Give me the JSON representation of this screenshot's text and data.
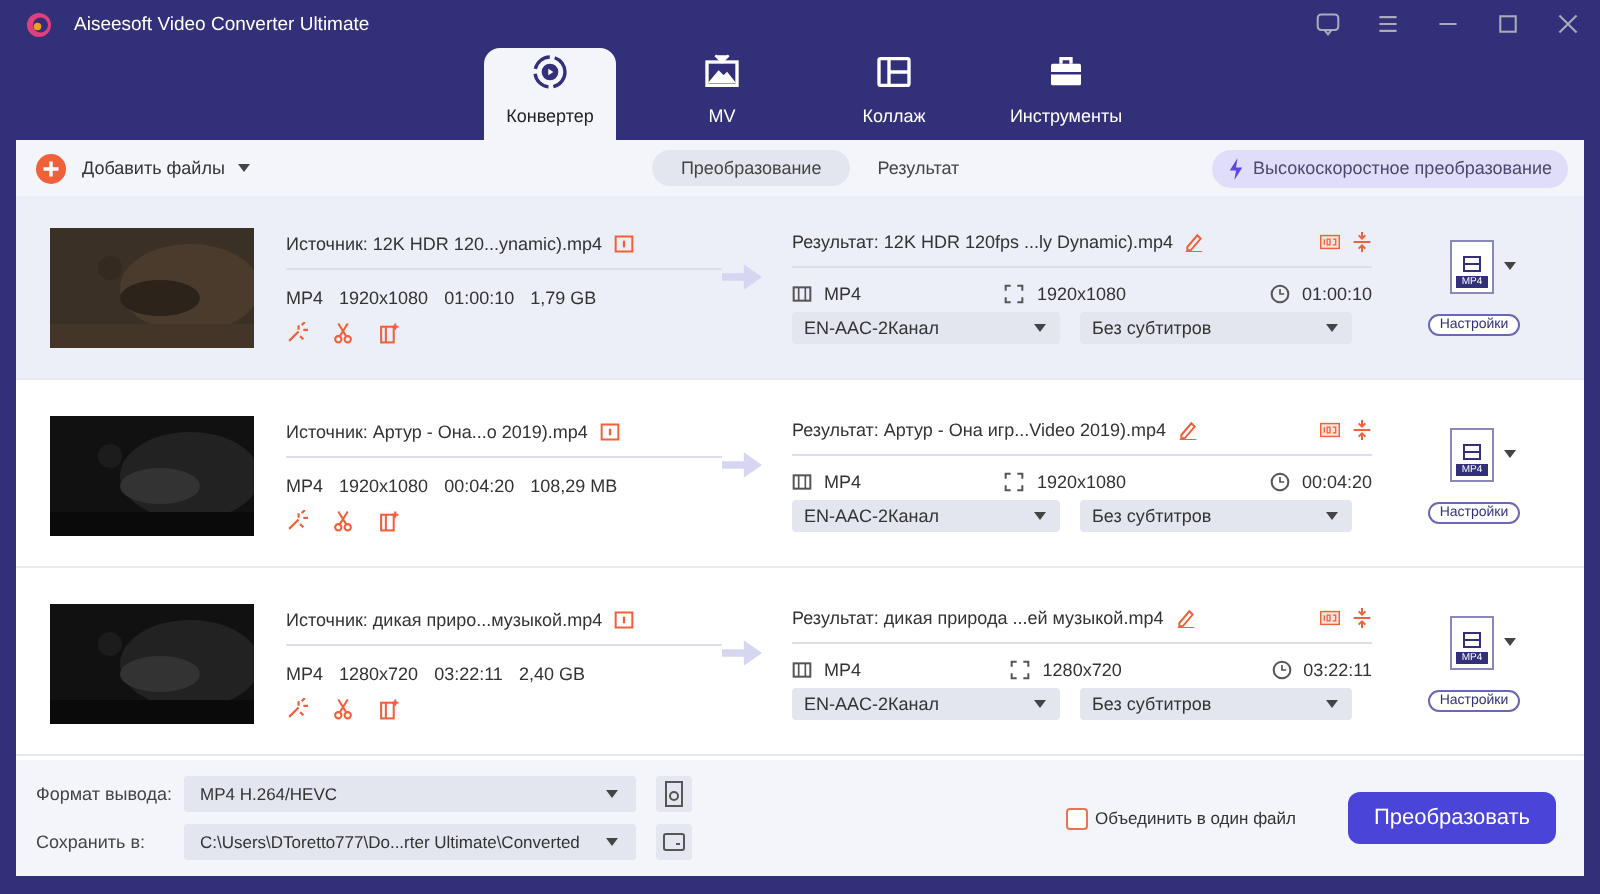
{
  "window": {
    "title": "Aiseesoft Video Converter Ultimate"
  },
  "tabs": [
    {
      "label": "Конвертер",
      "selected": true,
      "kind": "convert"
    },
    {
      "label": "MV",
      "selected": false,
      "kind": "mv"
    },
    {
      "label": "Коллаж",
      "selected": false,
      "kind": "collage"
    },
    {
      "label": "Инструменты",
      "selected": false,
      "kind": "tools"
    }
  ],
  "toolbar": {
    "add_files": "Добавить файлы",
    "views": [
      {
        "label": "Преобразование",
        "selected": true
      },
      {
        "label": "Результат",
        "selected": false
      }
    ],
    "hw_accel": "Высокоскоростное преобразование"
  },
  "files": [
    {
      "selected": true,
      "source": "Источник: 12K HDR 120...ynamic).mp4",
      "format": "MP4",
      "resolution": "1920x1080",
      "duration": "01:00:10",
      "size": "1,79 GB",
      "result": "Результат: 12K HDR 120fps ...ly Dynamic).mp4",
      "out_format": "MP4",
      "out_resolution": "1920x1080",
      "out_duration": "01:00:10",
      "audio": "EN-AAC-2Канал",
      "subtitle": "Без субтитров",
      "format_badge": "MP4",
      "settings": "Настройки"
    },
    {
      "selected": false,
      "source": "Источник: Артур - Она...о 2019).mp4",
      "format": "MP4",
      "resolution": "1920x1080",
      "duration": "00:04:20",
      "size": "108,29 MB",
      "result": "Результат: Артур - Она игр...Video 2019).mp4",
      "out_format": "MP4",
      "out_resolution": "1920x1080",
      "out_duration": "00:04:20",
      "audio": "EN-AAC-2Канал",
      "subtitle": "Без субтитров",
      "format_badge": "MP4",
      "settings": "Настройки"
    },
    {
      "selected": false,
      "source": "Источник: дикая приро...музыкой.mp4",
      "format": "MP4",
      "resolution": "1280x720",
      "duration": "03:22:11",
      "size": "2,40 GB",
      "result": "Результат: дикая природа ...ей музыкой.mp4",
      "out_format": "MP4",
      "out_resolution": "1280x720",
      "out_duration": "03:22:11",
      "audio": "EN-AAC-2Канал",
      "subtitle": "Без субтитров",
      "format_badge": "MP4",
      "settings": "Настройки"
    }
  ],
  "bottom": {
    "output_format_label": "Формат вывода:",
    "output_format": "MP4 H.264/HEVC",
    "save_label": "Сохранить в:",
    "save_path": "C:\\Users\\DToretto777\\Do...rter Ultimate\\Converted",
    "merge": {
      "label": "Объединить в один файл",
      "checked": false
    },
    "convert": "Преобразовать"
  }
}
